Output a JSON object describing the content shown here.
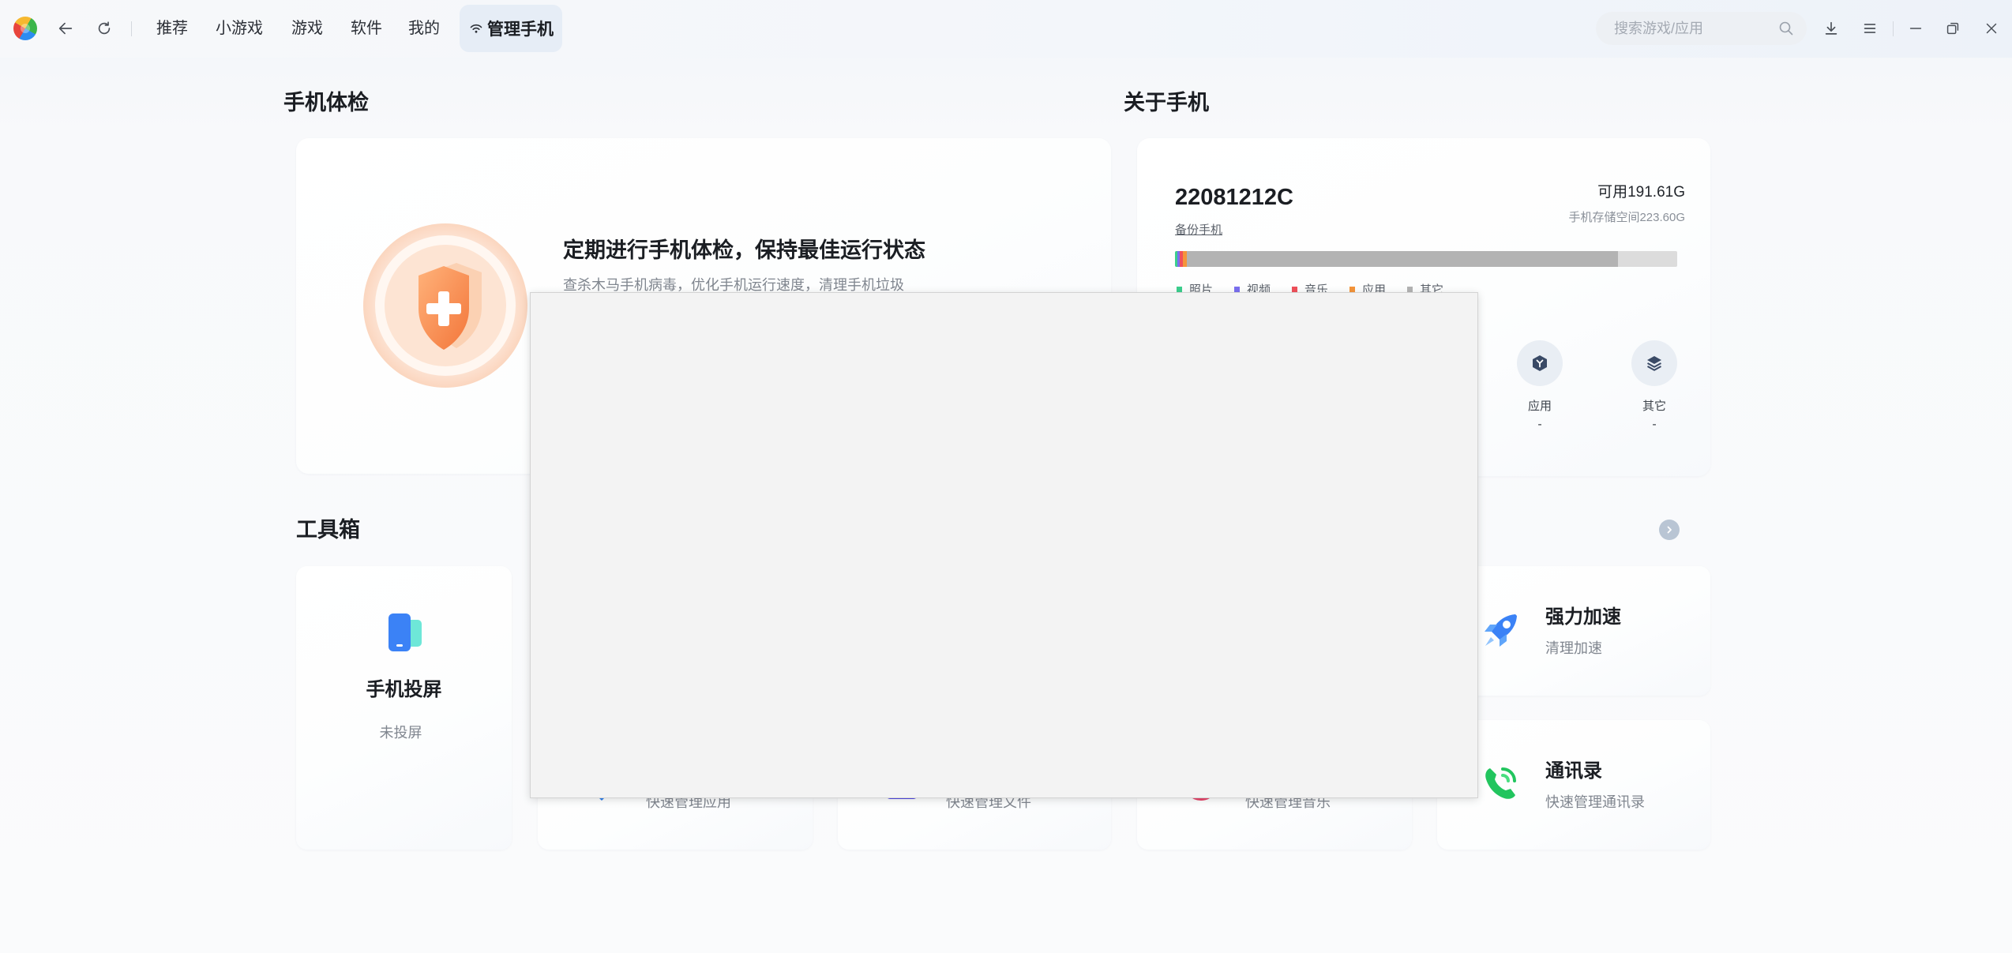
{
  "colors": {
    "page_bg": "#f8f9fb",
    "text_primary": "#1f2329",
    "text_secondary": "#80868f",
    "active_tab_bg": "#e6edf6",
    "overlay_bg": "#f3f3f3",
    "accent_blue": "#3b82f6"
  },
  "titlebar": {
    "logo_icon": "app-logo-icon",
    "back_icon": "arrow-left-icon",
    "refresh_icon": "refresh-icon",
    "nav": [
      {
        "label": "推荐",
        "active": false
      },
      {
        "label": "小游戏",
        "active": false
      },
      {
        "label": "游戏",
        "active": false
      },
      {
        "label": "软件",
        "active": false
      },
      {
        "label": "我的",
        "active": false
      },
      {
        "label": "管理手机",
        "active": true,
        "icon": "wifi-icon"
      }
    ],
    "search": {
      "placeholder": "搜索游戏/应用",
      "icon": "search-icon"
    },
    "controls": [
      "download-icon",
      "menu-icon",
      "minimize-icon",
      "restore-icon",
      "close-icon"
    ]
  },
  "checkup": {
    "heading": "手机体检",
    "icon": "shield-plus-icon",
    "title": "定期进行手机体检，保持最佳运行状态",
    "subtitle": "查杀木马手机病毒，优化手机运行速度，清理手机垃圾"
  },
  "about": {
    "heading": "关于手机",
    "model": "22081212C",
    "backup_link": "备份手机",
    "available": "可用191.61G",
    "capacity": "手机存储空间223.60G",
    "storage": [
      {
        "label": "照片",
        "color": "#3ccf8e",
        "fraction": 0.005
      },
      {
        "label": "视频",
        "color": "#7a6ff0",
        "fraction": 0.005
      },
      {
        "label": "音乐",
        "color": "#f0505a",
        "fraction": 0.005
      },
      {
        "label": "应用",
        "color": "#f5953a",
        "fraction": 0.008
      },
      {
        "label": "其它",
        "color": "#b3b3b3",
        "fraction": 0.859
      }
    ],
    "storage_free_color": "#dcdcdc",
    "categories": [
      {
        "label": "应用",
        "value": "-",
        "icon": "app-hexagon-icon"
      },
      {
        "label": "其它",
        "value": "-",
        "icon": "layers-icon"
      }
    ]
  },
  "toolbox": {
    "heading": "工具箱",
    "next_icon": "chevron-right-icon",
    "cards": [
      {
        "title": "手机投屏",
        "subtitle": "未投屏",
        "icon": "phone-cast-icon"
      },
      {
        "title": "强力加速",
        "subtitle": "清理加速",
        "icon": "rocket-icon"
      },
      {
        "subtitle": "快速管理应用",
        "icon": "app-manage-icon"
      },
      {
        "subtitle": "快速管理文件",
        "icon": "file-manage-icon"
      },
      {
        "subtitle": "快速管理音乐",
        "icon": "music-manage-icon"
      },
      {
        "title": "通讯录",
        "subtitle": "快速管理通讯录",
        "icon": "contacts-icon"
      }
    ]
  }
}
